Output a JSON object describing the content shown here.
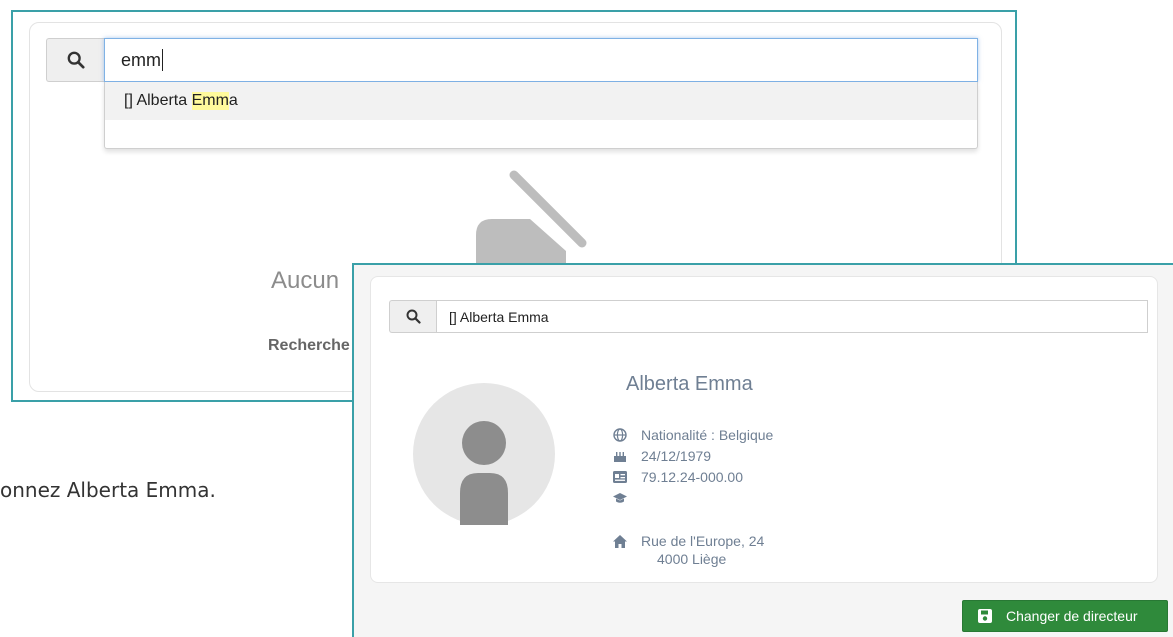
{
  "search_panel": {
    "query": "emm",
    "suggestions": [
      {
        "prefix": "[] Alberta ",
        "match": "Emm",
        "suffix": "a"
      }
    ],
    "empty_title_fragment": "Aucun",
    "empty_subtitle_fragment": "Recherche"
  },
  "caption": {
    "text": "onnez Alberta Emma."
  },
  "result_panel": {
    "search_value": "[] Alberta Emma",
    "person": {
      "name": "Alberta Emma",
      "nationality": "Nationalité : Belgique",
      "birth_date": "24/12/1979",
      "national_number": "79.12.24-000.00",
      "education": "",
      "address_line1": "Rue de l'Europe, 24",
      "address_line2": "4000 Liège"
    },
    "primary_button_label": "Changer de directeur"
  },
  "colors": {
    "frame_border": "#3aa0a8",
    "primary_button": "#2f8a3b",
    "highlight": "#fffa9c",
    "info_text": "#6f7f93"
  },
  "icons": {
    "search": "search-icon",
    "empty_state": "user-slash-icon",
    "nationality": "globe-icon",
    "birth": "birthday-cake-icon",
    "id": "id-card-icon",
    "education": "graduation-cap-icon",
    "address": "home-icon",
    "save": "save-icon"
  }
}
